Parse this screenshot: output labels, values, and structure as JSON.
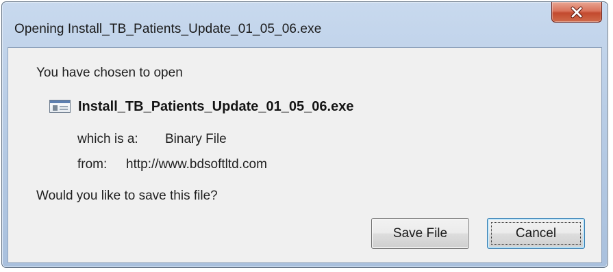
{
  "window": {
    "title": "Opening Install_TB_Patients_Update_01_05_06.exe",
    "close_icon": "close-x-icon"
  },
  "dialog": {
    "heading": "You have chosen to open",
    "file_icon": "executable-file-icon",
    "filename": "Install_TB_Patients_Update_01_05_06.exe",
    "which_is_label": "which is a:",
    "which_is_value": "Binary File",
    "from_label": "from:",
    "from_value": "http://www.bdsoftltd.com",
    "question": "Would you like to save this file?"
  },
  "buttons": {
    "save_label": "Save File",
    "cancel_label": "Cancel",
    "focused": "Cancel"
  },
  "colors": {
    "title_bar": "#b9cde6",
    "close_button": "#c24a2f",
    "client_background": "#f0f0f0",
    "focus_border": "#3c7fb1"
  }
}
